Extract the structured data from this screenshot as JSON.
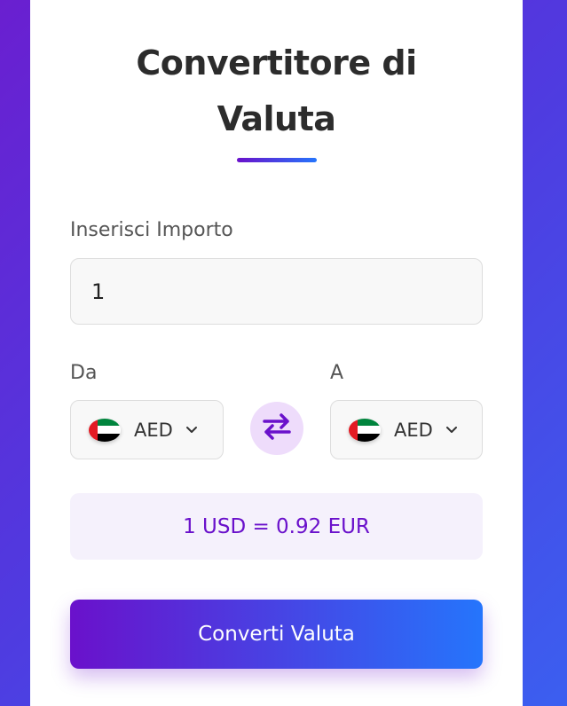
{
  "header": {
    "title": "Convertitore di Valuta"
  },
  "amount": {
    "label": "Inserisci Importo",
    "value": "1"
  },
  "from": {
    "label": "Da",
    "currency_code": "AED",
    "flag_icon": "uae-flag-icon"
  },
  "to": {
    "label": "A",
    "currency_code": "AED",
    "flag_icon": "uae-flag-icon"
  },
  "swap": {
    "icon": "swap-arrows-icon"
  },
  "rate": {
    "text": "1 USD = 0.92 EUR"
  },
  "convert": {
    "label": "Converti Valuta"
  },
  "colors": {
    "accent_start": "#6a11cb",
    "accent_end": "#2575fc",
    "swap_bg": "#eedcfb",
    "rate_bg": "#f5f1fc"
  }
}
